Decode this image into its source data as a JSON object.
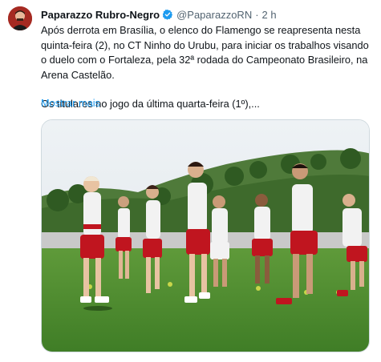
{
  "tweet": {
    "author_name": "Paparazzo Rubro-Negro",
    "handle": "@PaparazzoRN",
    "separator": "·",
    "time": "2 h",
    "paragraph1": "Após derrota em Brasília, o elenco do Flamengo se reapresenta nesta quinta-feira (2), no CT Ninho do Urubu, para iniciar os trabalhos visando o duelo com o Fortaleza, pela 32ª rodada do Campeonato Brasileiro, na Arena Castelão.",
    "paragraph2": "Os titulares no jogo da última quarta-feira (1º),...",
    "show_more": "Mostrar mais",
    "verified_icon": "verified-badge-icon",
    "colors": {
      "link": "#1d9bf0",
      "verified": "#1d9bf0",
      "secondary_text": "#536471"
    }
  }
}
